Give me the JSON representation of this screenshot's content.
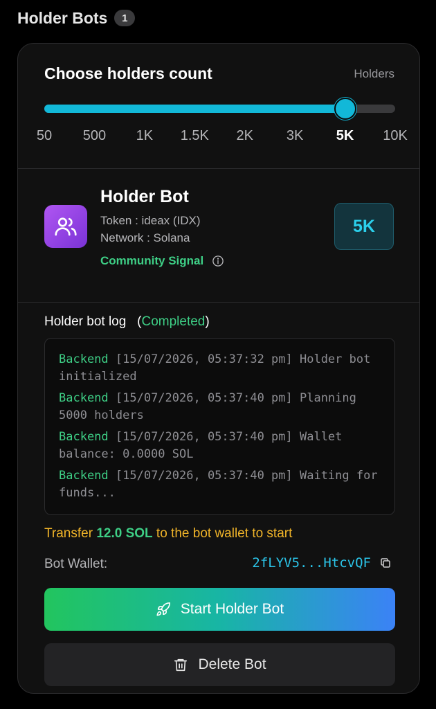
{
  "header": {
    "title": "Holder Bots",
    "count": "1"
  },
  "holders": {
    "title": "Choose holders count",
    "aux_label": "Holders",
    "options": [
      "50",
      "500",
      "1K",
      "1.5K",
      "2K",
      "3K",
      "5K",
      "10K"
    ],
    "selected": "5K",
    "selected_index": 6
  },
  "bot": {
    "name": "Holder Bot",
    "token": "Token : ideax (IDX)",
    "network": "Network : Solana",
    "signal": "Community Signal",
    "count": "5K",
    "icon": "users-icon"
  },
  "log": {
    "title": "Holder bot log",
    "status_open": "(",
    "status": "Completed",
    "status_close": ")",
    "entries": [
      {
        "source": "Backend",
        "text": " [15/07/2026, 05:37:32 pm] Holder bot initialized"
      },
      {
        "source": "Backend",
        "text": " [15/07/2026, 05:37:40 pm] Planning 5000 holders"
      },
      {
        "source": "Backend",
        "text": " [15/07/2026, 05:37:40 pm] Wallet balance: 0.0000 SOL"
      },
      {
        "source": "Backend",
        "text": " [15/07/2026, 05:37:40 pm] Waiting for funds..."
      }
    ]
  },
  "transfer": {
    "prefix": "Transfer ",
    "amount": "12.0 SOL",
    "suffix": " to the bot wallet to start"
  },
  "wallet": {
    "label": "Bot Wallet:",
    "value": "2fLYV5...HtcvQF"
  },
  "actions": {
    "start_label": "Start Holder Bot",
    "delete_label": "Delete Bot"
  },
  "colors": {
    "accent": "#12b8d8",
    "success": "#3ecf86",
    "warning": "#f0b429",
    "bot_icon": "#9b47e8"
  }
}
